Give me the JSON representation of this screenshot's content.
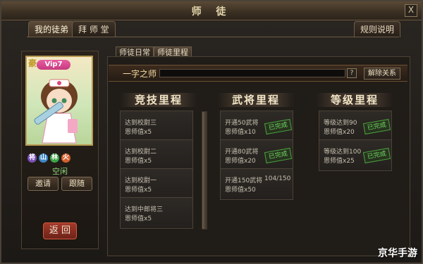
{
  "window": {
    "title": "师 徒",
    "close_label": "X"
  },
  "top_tabs": {
    "my_apprentice": "我的徒弟",
    "apprentice_hall": "拜 师 堂",
    "rules": "规则说明"
  },
  "sub_tabs": {
    "daily": "师徒日常",
    "milestone": "师徒里程"
  },
  "character": {
    "rank_char": "豪",
    "vip": "Vip7",
    "stats": [
      "将",
      "山",
      "林",
      "火"
    ],
    "stat_colors": [
      "#7a4fb8",
      "#3f86c9",
      "#3ca34a",
      "#d3612d"
    ],
    "status": "空闲",
    "invite_label": "邀请",
    "follow_label": "跟随"
  },
  "back_label": "返 回",
  "master_row": {
    "title": "一字之师",
    "help": "?",
    "dissolve": "解除关系",
    "progress": 0
  },
  "columns": [
    {
      "title": "竞技里程",
      "cards": [
        {
          "line1": "达到校尉三",
          "line2": "恩师值x5"
        },
        {
          "line1": "达到校尉二",
          "line2": "恩师值x5"
        },
        {
          "line1": "达到校尉一",
          "line2": "恩师值x5"
        },
        {
          "line1": "达到中郎将三",
          "line2": "恩师值x5"
        }
      ]
    },
    {
      "title": "武将里程",
      "cards": [
        {
          "line1": "开通50武将",
          "line2": "恩师值x10",
          "stamp": "已完成"
        },
        {
          "line1": "开通80武将",
          "line2": "恩师值x20",
          "stamp": "已完成"
        },
        {
          "line1": "开通150武将",
          "line2": "恩师值x50",
          "progress": "104/150"
        }
      ]
    },
    {
      "title": "等级里程",
      "cards": [
        {
          "line1": "等级达到90",
          "line2": "恩师值x20",
          "stamp": "已完成"
        },
        {
          "line1": "等级达到100",
          "line2": "恩师值x25",
          "stamp": "已完成"
        }
      ]
    }
  ],
  "watermark": "京华手游"
}
